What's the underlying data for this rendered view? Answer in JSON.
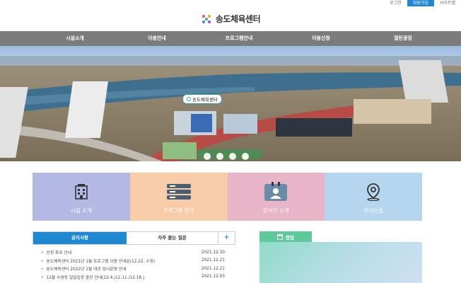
{
  "util": {
    "login": "로그인",
    "join": "회원가입",
    "sitemap": "사이트맵"
  },
  "logo": {
    "text": "송도체육센터"
  },
  "gnb": [
    "시설소개",
    "이용안내",
    "프로그램안내",
    "이용신청",
    "열린광장"
  ],
  "hero": {
    "label": "송도체육센터"
  },
  "quick": [
    {
      "label": "시설 소개",
      "color": "#b3b9e3",
      "icon": "building-icon"
    },
    {
      "label": "프로그램 안내",
      "color": "#f8cba9",
      "icon": "server-list-icon"
    },
    {
      "label": "강사진 소개",
      "color": "#e8b4c7",
      "icon": "id-card-icon"
    },
    {
      "label": "오시는길",
      "color": "#b5d6ee",
      "icon": "location-pin-icon"
    }
  ],
  "board": {
    "tab_notice": "공지사항",
    "tab_faq": "자주 묻는 질문",
    "more": "+",
    "items": [
      {
        "title": "신정 휴무 안내",
        "date": "2021.12.30"
      },
      {
        "title": "송도체육센터 2021년 1월 프로그램 이용 안내문(12.22. 수정)",
        "date": "2021.12.21"
      },
      {
        "title": "송도체육센터 2022년 1월 대관 임시운영 안내",
        "date": "2021.12.21"
      },
      {
        "title": "12월 수영장 일일입장 중단 안내(12.4./12.11./12.18.)",
        "date": "2021.12.03"
      }
    ]
  },
  "popup": {
    "title": "팝업"
  }
}
